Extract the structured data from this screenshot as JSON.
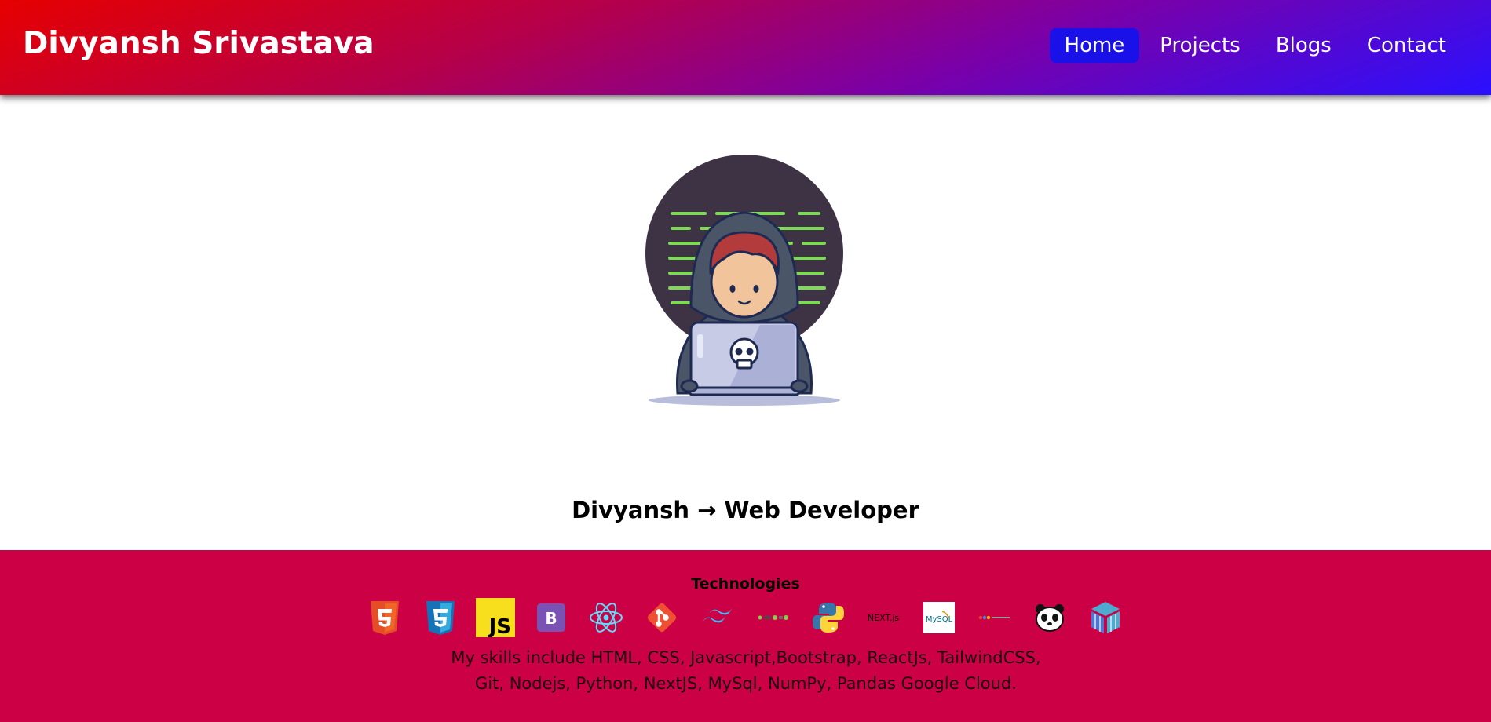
{
  "header": {
    "brand": "Divyansh Srivastava",
    "nav": [
      {
        "label": "Home",
        "active": true
      },
      {
        "label": "Projects",
        "active": false
      },
      {
        "label": "Blogs",
        "active": false
      },
      {
        "label": "Contact",
        "active": false
      }
    ]
  },
  "hero": {
    "illustration": "developer-with-laptop-illustration",
    "headline": "Divyansh → Web Developer"
  },
  "technologies": {
    "title": "Technologies",
    "icons": [
      "html5-icon",
      "css3-icon",
      "javascript-icon",
      "bootstrap-icon",
      "react-icon",
      "git-icon",
      "tailwindcss-icon",
      "nodejs-icon",
      "python-icon",
      "nextjs-icon",
      "mysql-icon",
      "google-cloud-icon",
      "pandas-icon",
      "numpy-icon"
    ],
    "nextjs_text": "NEXT.js",
    "js_text": "JS",
    "bootstrap_text": "B",
    "mysql_text": "MySQL",
    "skills_text": "My skills include HTML, CSS, Javascript,Bootstrap, ReactJs, TailwindCSS, Git, Nodejs, Python, NextJS, MySql, NumPy, Pandas Google Cloud."
  },
  "colors": {
    "nav_active_bg": "#1a10e8",
    "tech_bg": "#cc0044",
    "gradient": [
      "#e60000",
      "#7a00a8",
      "#2a10ff"
    ]
  }
}
